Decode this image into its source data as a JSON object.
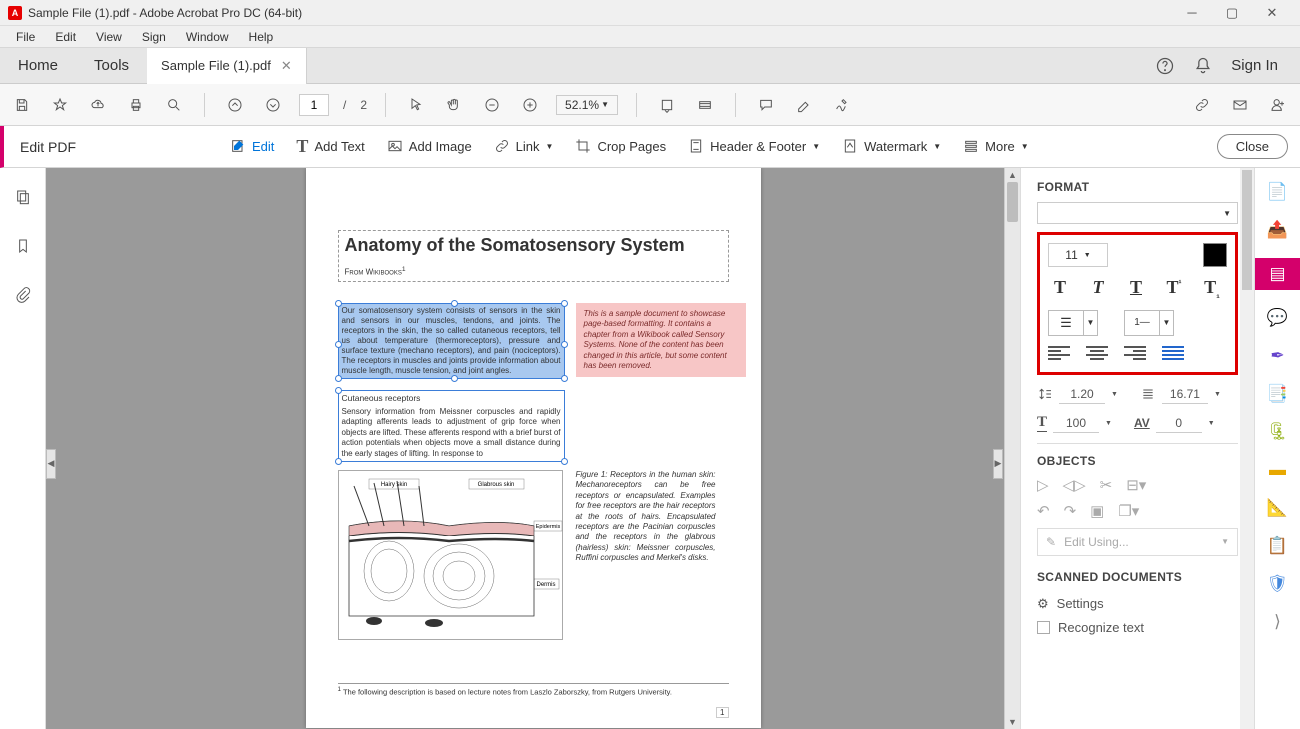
{
  "titlebar": {
    "title": "Sample File (1).pdf - Adobe Acrobat Pro DC (64-bit)"
  },
  "menubar": [
    "File",
    "Edit",
    "View",
    "Sign",
    "Window",
    "Help"
  ],
  "tabs": {
    "home": "Home",
    "tools": "Tools",
    "file": "Sample File (1).pdf",
    "signin": "Sign In"
  },
  "toolbar": {
    "page": "1",
    "page_sep": "/",
    "total": "2",
    "zoom": "52.1%"
  },
  "editbar": {
    "title": "Edit PDF",
    "edit": "Edit",
    "addtext": "Add Text",
    "addimage": "Add Image",
    "link": "Link",
    "crop": "Crop Pages",
    "header": "Header & Footer",
    "watermark": "Watermark",
    "more": "More",
    "close": "Close"
  },
  "doc": {
    "title": "Anatomy of the Somatosensory System",
    "subtitle": "From Wikibooks",
    "sup": "1",
    "para1": "Our somatosensory system consists of sensors in the skin and sensors in our muscles, tendons, and joints. The receptors in the skin, the so called cutaneous receptors, tell us about temperature (thermoreceptors), pressure and surface texture (mechano receptors), and pain (nociceptors). The receptors in muscles and joints provide information about muscle length, muscle tension, and joint angles.",
    "callout": "This is a sample document to showcase page-based formatting. It contains a chapter from a Wikibook called Sensory Systems. None of the content has been changed in this article, but some content has been removed.",
    "h2": "Cutaneous receptors",
    "para2": "Sensory information from Meissner corpuscles and rapidly adapting afferents leads to adjustment of grip force when objects are lifted. These afferents respond with a brief burst of action potentials when objects move a small distance during the early stages of lifting. In response to",
    "figcap": "Figure 1: Receptors in the human skin: Mechanoreceptors can be free receptors or encapsulated. Examples for free receptors are the hair receptors at the roots of hairs. Encapsulated receptors are the Pacinian corpuscles and the receptors in the glabrous (hairless) skin: Meissner corpuscles, Ruffini corpuscles and Merkel's disks.",
    "fig_labels": {
      "hairy": "Hairy skin",
      "glabrous": "Glabrous skin",
      "epidermis": "Epidermis",
      "dermis": "Dermis"
    },
    "footnote": "The following description is based on lecture notes from Laszlo Zaborszky, from Rutgers University.",
    "pgnum": "1"
  },
  "format": {
    "heading": "FORMAT",
    "size": "11",
    "line": "1.20",
    "para": "16.71",
    "hscale": "100",
    "tracking": "0",
    "objects": "OBJECTS",
    "editusing": "Edit Using...",
    "scanned": "SCANNED DOCUMENTS",
    "settings": "Settings",
    "recognize": "Recognize text"
  }
}
